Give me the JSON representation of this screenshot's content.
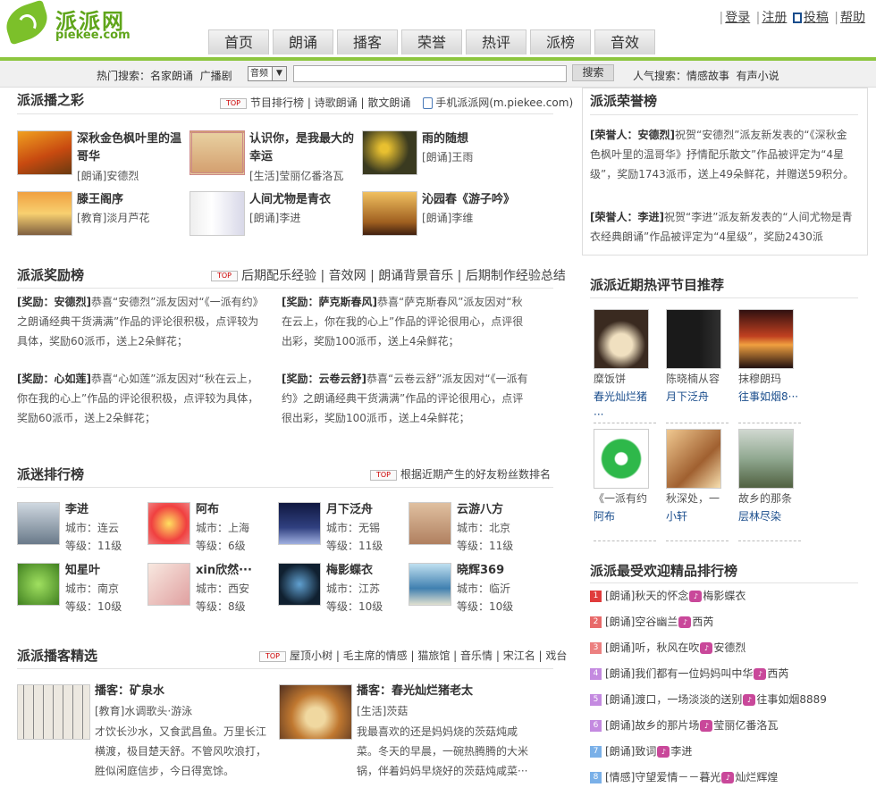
{
  "header": {
    "logo_cn": "派派网",
    "logo_en": "piekee.com",
    "toplinks": [
      "登录",
      "注册",
      "投稿",
      "帮助"
    ],
    "nav": [
      "首页",
      "朗诵",
      "播客",
      "荣誉",
      "热评",
      "派榜",
      "音效"
    ]
  },
  "search": {
    "hot_label": "热门搜索：",
    "hot_items": [
      "名家朗诵",
      "广播剧"
    ],
    "select_value": "音频",
    "button": "搜索",
    "pop_label": "人气搜索：",
    "pop_items": [
      "情感故事",
      "有声小说"
    ]
  },
  "sec1": {
    "title": "派派播之彩",
    "top": "TOP",
    "links": "节目排行榜 | 诗歌朗诵 | 散文朗诵",
    "mobile": "手机派派网(m.piekee.com)",
    "items": [
      {
        "title": "深秋金色枫叶里的温哥华",
        "meta": "[朗诵]安德烈"
      },
      {
        "title": "认识你，是我最大的幸运",
        "meta": "[生活]莹丽亿番洛瓦"
      },
      {
        "title": "雨的随想",
        "meta": "[朗诵]王雨"
      },
      {
        "title": "滕王阁序",
        "meta": "[教育]淡月芦花"
      },
      {
        "title": "人间尤物是青衣",
        "meta": "[朗诵]李进"
      },
      {
        "title": "沁园春《游子吟》",
        "meta": "[朗诵]李维"
      }
    ]
  },
  "sec2": {
    "title": "派派奖励榜",
    "top": "TOP",
    "links": "后期配乐经验 | 音效网 | 朗诵背景音乐 | 后期制作经验总结",
    "awards": [
      {
        "who": "[奖励：安德烈]",
        "text": "恭喜“安德烈”派友因对“《一派有约》之朗诵经典干货满满”作品的评论很积极，点评较为具体，奖励60派币，送上2朵鲜花；"
      },
      {
        "who": "[奖励：萨克斯春风]",
        "text": "恭喜“萨克斯春风”派友因对“秋在云上，你在我的心上”作品的评论很用心，点评很出彩，奖励100派币，送上4朵鲜花；"
      },
      {
        "who": "[奖励：心如莲]",
        "text": "恭喜“心如莲”派友因对“秋在云上，你在我的心上”作品的评论很积极，点评较为具体，奖励60派币，送上2朵鲜花；"
      },
      {
        "who": "[奖励：云卷云舒]",
        "text": "恭喜“云卷云舒”派友因对“《一派有约》之朗诵经典干货满满”作品的评论很用心，点评很出彩，奖励100派币，送上4朵鲜花；"
      }
    ]
  },
  "sec3": {
    "title": "派迷排行榜",
    "top": "TOP",
    "links": "根据近期产生的好友粉丝数排名",
    "fans": [
      {
        "name": "李进",
        "city": "城市：连云",
        "level": "等级：11级"
      },
      {
        "name": "阿布",
        "city": "城市：上海",
        "level": "等级：6级"
      },
      {
        "name": "月下泛舟",
        "city": "城市：无锡",
        "level": "等级：11级"
      },
      {
        "name": "云游八方",
        "city": "城市：北京",
        "level": "等级：11级"
      },
      {
        "name": "知星叶",
        "city": "城市：南京",
        "level": "等级：10级"
      },
      {
        "name": "xin欣然···",
        "city": "城市：西安",
        "level": "等级：8级"
      },
      {
        "name": "梅影蝶衣",
        "city": "城市：江苏",
        "level": "等级：10级"
      },
      {
        "name": "晓辉369",
        "city": "城市：临沂",
        "level": "等级：10级"
      }
    ]
  },
  "sec4": {
    "title": "派派播客精选",
    "top": "TOP",
    "links": "屋顶小树 | 毛主席的情感 | 猫旅馆 | 音乐情 | 宋江名 | 戏台",
    "items": [
      {
        "title": "播客：矿泉水",
        "meta": "[教育]水调歌头·游泳",
        "desc": "才饮长沙水，又食武昌鱼。万里长江横渡，极目楚天舒。不管风吹浪打，胜似闲庭信步，今日得宽馀。"
      },
      {
        "title": "播客：春光灿烂猪老太",
        "meta": "[生活]茨菇",
        "desc": "我最喜欢的还是妈妈烧的茨菇炖咸菜。冬天的早晨，一碗热腾腾的大米锅，伴着妈妈早烧好的茨菇炖咸菜···"
      }
    ]
  },
  "right1": {
    "title": "派派荣誉榜",
    "items": [
      {
        "who": "[荣誉人：安德烈]",
        "text": "祝贺“安德烈”派友新发表的“《深秋金色枫叶里的温哥华》抒情配乐散文”作品被评定为“4星级”，奖励1743派币，送上49朵鲜花，并赠送59积分。"
      },
      {
        "who": "[荣誉人：李进]",
        "text": "祝贺“李进”派友新发表的“人间尤物是青衣经典朗诵”作品被评定为“4星级”，奖励2430派"
      }
    ]
  },
  "right2": {
    "title": "派派近期热评节目推荐",
    "items": [
      {
        "cap": "糜饭饼",
        "author": "春光灿烂猪···"
      },
      {
        "cap": "陈晓楠从容",
        "author": "月下泛舟"
      },
      {
        "cap": "抹穆朗玛",
        "author": "往事如烟8···"
      },
      {
        "cap": "《一派有约",
        "author": "阿布"
      },
      {
        "cap": "秋深处，一",
        "author": "小轩"
      },
      {
        "cap": "故乡的那条",
        "author": "层林尽染"
      }
    ]
  },
  "right3": {
    "title": "派派最受欢迎精品排行榜",
    "items": [
      {
        "n": "1",
        "t": "[朗诵]秋天的怀念",
        "a": "梅影蝶衣",
        "c": "#e03c3c"
      },
      {
        "n": "2",
        "t": "[朗诵]空谷幽兰",
        "a": "西芮",
        "c": "#e86a6a"
      },
      {
        "n": "3",
        "t": "[朗诵]听，秋风在吹",
        "a": "安德烈",
        "c": "#ec8080"
      },
      {
        "n": "4",
        "t": "[朗诵]我们都有一位妈妈叫中华",
        "a": "西芮",
        "c": "#c48ae0"
      },
      {
        "n": "5",
        "t": "[朗诵]渡口，一场淡淡的送别",
        "a": "往事如烟8889",
        "c": "#c48ae0"
      },
      {
        "n": "6",
        "t": "[朗诵]故乡的那片场",
        "a": "莹丽亿番洛瓦",
        "c": "#c48ae0"
      },
      {
        "n": "7",
        "t": "[朗诵]致词",
        "a": "李进",
        "c": "#7ab0e8"
      },
      {
        "n": "8",
        "t": "[情感]守望爱情－－暮光",
        "a": "灿烂辉煌",
        "c": "#7ab0e8"
      }
    ]
  }
}
